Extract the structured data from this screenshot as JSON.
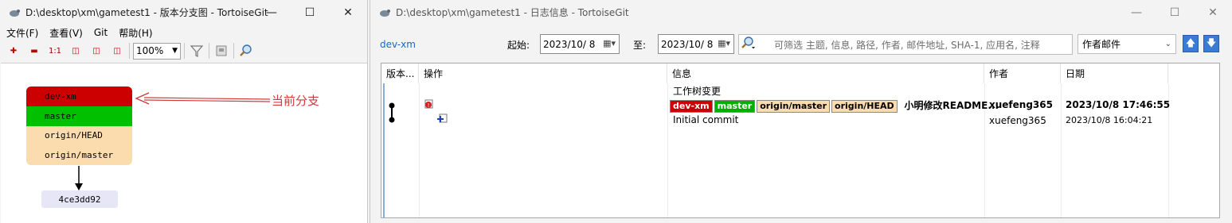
{
  "left_window": {
    "title": "D:\\desktop\\xm\\gametest1 - 版本分支图 - TortoiseGit",
    "menu": [
      "文件(F)",
      "查看(V)",
      "Git",
      "帮助(H)"
    ],
    "toolbar": {
      "zoom_value": "100%",
      "one_to_one_label": "1:1"
    },
    "graph": {
      "refs": [
        {
          "name": "dev-xm",
          "color": "#cc0000"
        },
        {
          "name": "master",
          "color": "#00c000"
        },
        {
          "name": "origin/HEAD",
          "color": "#fbdcae"
        },
        {
          "name": "origin/master",
          "color": "#fbdcae"
        }
      ],
      "commit_hash": "4ce3dd92",
      "annotation": "当前分支"
    }
  },
  "right_window": {
    "title": "D:\\desktop\\xm\\gametest1 - 日志信息 - TortoiseGit",
    "branch": "dev-xm",
    "from_label": "起始:",
    "from_date": "2023/10/  8",
    "to_label": "至:",
    "to_date": "2023/10/  8",
    "search_placeholder": "可筛选 主题, 信息, 路径, 作者, 邮件地址, SHA-1, 应用名, 注释",
    "author_filter": "作者邮件",
    "columns": [
      "版本...",
      "操作",
      "信息",
      "作者",
      "日期"
    ],
    "rows": [
      {
        "message": "工作树变更",
        "author": "",
        "date": ""
      },
      {
        "refs": [
          {
            "name": "dev-xm",
            "bg": "#cc0000",
            "fg": "#ffffff"
          },
          {
            "name": "master",
            "bg": "#00b000",
            "fg": "#ffffff"
          },
          {
            "name": "origin/master",
            "bg": "#fbdcae",
            "fg": "#000000"
          },
          {
            "name": "origin/HEAD",
            "bg": "#fbdcae",
            "fg": "#000000"
          }
        ],
        "message": "小明修改README...",
        "author": "xuefeng365",
        "date": "2023/10/8 17:46:55"
      },
      {
        "message": "Initial commit",
        "author": "xuefeng365",
        "date": "2023/10/8 16:04:21"
      }
    ]
  },
  "icons": {
    "app": "tortoise-icon",
    "minimize": "minimize-icon",
    "maximize": "maximize-icon",
    "close": "close-icon"
  }
}
